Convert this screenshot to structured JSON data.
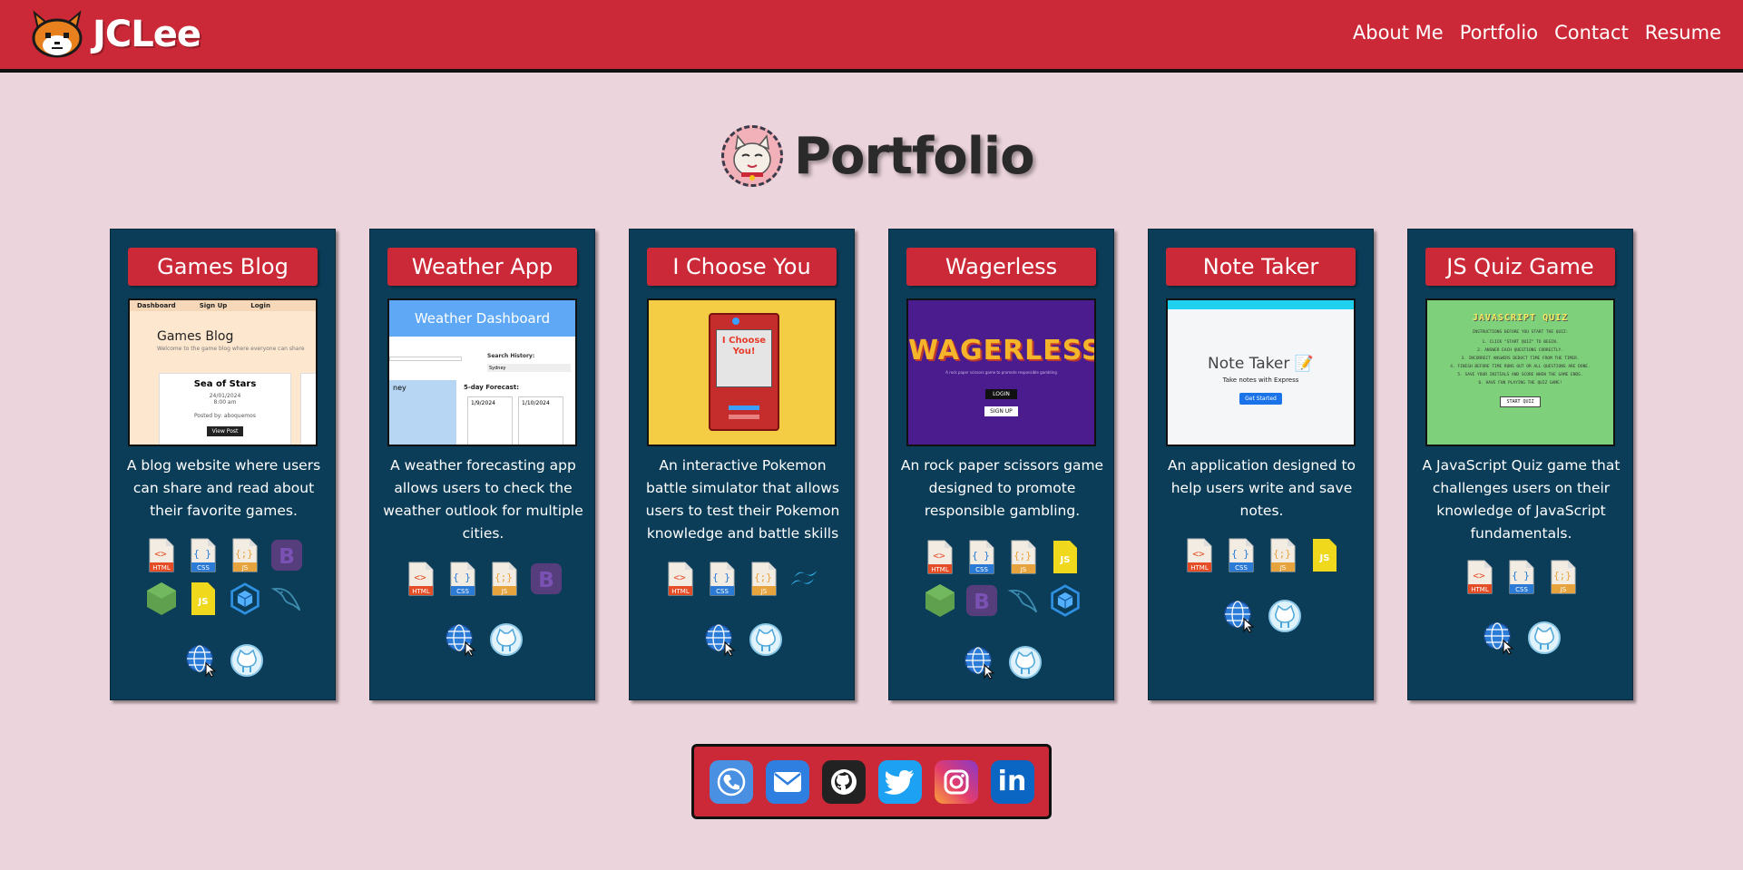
{
  "nav": {
    "brand": "JCLee",
    "links": [
      "About Me",
      "Portfolio",
      "Contact",
      "Resume"
    ]
  },
  "section": {
    "title": "Portfolio"
  },
  "projects": [
    {
      "title": "Games Blog",
      "description": "A blog website where users can share and read about their favorite games.",
      "thumb": {
        "nav": [
          "Dashboard",
          "Sign Up",
          "Login"
        ],
        "heading": "Games Blog",
        "subheading": "Welcome to the game blog where everyone can share",
        "post_title": "Sea of Stars",
        "post_date": "24/01/2024",
        "post_time": "8:00 am",
        "post_author": "Posted by: aboquemos",
        "button": "View Post"
      },
      "tech": [
        "html",
        "css",
        "js",
        "bootstrap",
        "node",
        "js-badge",
        "sequelize",
        "mysql"
      ]
    },
    {
      "title": "Weather App",
      "description": "A weather forecasting app allows users to check the weather outlook for multiple cities.",
      "thumb": {
        "banner": "Weather Dashboard",
        "search_label": "Search History:",
        "search_item": "Sydney",
        "forecast_label": "5-day Forecast:",
        "city": "ney",
        "days": [
          "1/9/2024",
          "1/10/2024"
        ]
      },
      "tech": [
        "html",
        "css",
        "js",
        "bootstrap"
      ]
    },
    {
      "title": "I Choose You",
      "description": "An interactive Pokemon battle simulator that allows users to test their Pokemon knowledge and battle skills",
      "thumb": {
        "logo": "I Choose You!"
      },
      "tech": [
        "html",
        "css",
        "js",
        "tailwind"
      ]
    },
    {
      "title": "Wagerless",
      "description": "An rock paper scissors game designed to promote responsible gambling.",
      "thumb": {
        "logo": "WAGERLESS",
        "tagline": "A rock paper scissors game to promote responsible gambling",
        "login": "LOGIN",
        "signup": "SIGN UP"
      },
      "tech": [
        "html",
        "css",
        "js",
        "js-badge",
        "node",
        "bootstrap",
        "mysql",
        "sequelize"
      ]
    },
    {
      "title": "Note Taker",
      "description": "An application designed to help users write and save notes.",
      "thumb": {
        "heading": "Note Taker",
        "sub": "Take notes with Express",
        "button": "Get Started"
      },
      "tech": [
        "html",
        "css",
        "js",
        "js-badge"
      ]
    },
    {
      "title": "JS Quiz Game",
      "description": "A JavaScript Quiz game that challenges users on their knowledge of JavaScript fundamentals.",
      "thumb": {
        "heading": "JAVASCRIPT QUIZ",
        "intro": "INSTRUCTIONS BEFORE YOU START THE QUIZ:",
        "rules": [
          "1. CLICK \"START QUIZ\" TO BEGIN.",
          "2. ANSWER EACH QUESTIONS CORRECTLY.",
          "3. INCORRECT ANSWERS DEDUCT TIME FROM THE TIMER.",
          "4. FINISH BEFORE TIME RUNS OUT OR ALL QUESTIONS ARE DONE.",
          "5. SAVE YOUR INITIALS AND SCORE WHEN THE GAME ENDS.",
          "6. HAVE FUN PLAYING THE QUIZ GAME!"
        ],
        "button": "START QUIZ"
      },
      "tech": [
        "html",
        "css",
        "js"
      ]
    }
  ],
  "tech_labels": {
    "html": "HTML",
    "css": "CSS",
    "js": "JS",
    "js-badge": "JS",
    "bootstrap": "B"
  },
  "footer": {
    "socials": [
      "phone",
      "email",
      "github",
      "twitter",
      "instagram",
      "linkedin"
    ],
    "linkedin_text": "in"
  },
  "colors": {
    "brand_red": "#cb2937",
    "card_navy": "#0b3d58",
    "page_bg": "#ecd4dc"
  }
}
